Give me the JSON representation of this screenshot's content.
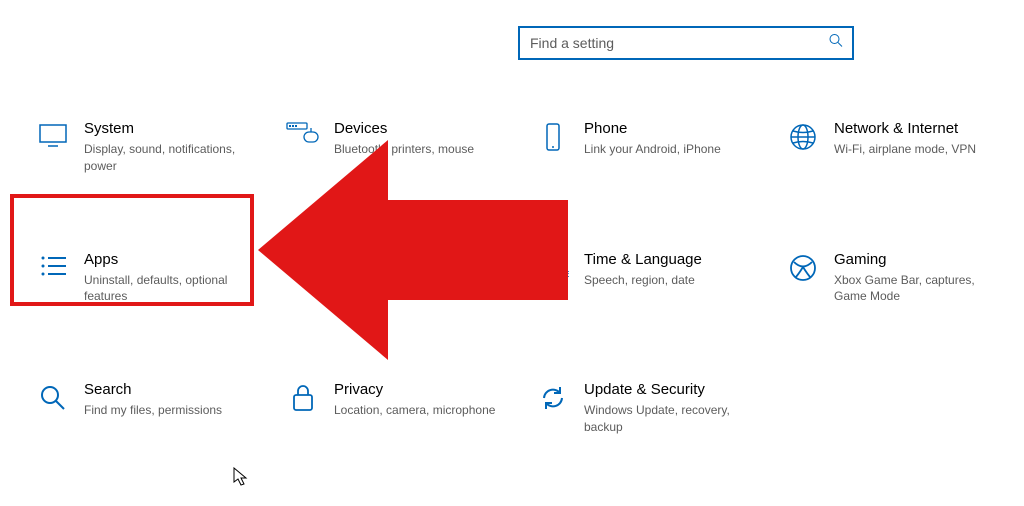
{
  "search": {
    "placeholder": "Find a setting"
  },
  "tiles": {
    "system": {
      "title": "System",
      "subtitle": "Display, sound, notifications, power"
    },
    "devices": {
      "title": "Devices",
      "subtitle": "Bluetooth, printers, mouse"
    },
    "phone": {
      "title": "Phone",
      "subtitle": "Link your Android, iPhone"
    },
    "network": {
      "title": "Network & Internet",
      "subtitle": "Wi-Fi, airplane mode, VPN"
    },
    "apps": {
      "title": "Apps",
      "subtitle": "Uninstall, defaults, optional features"
    },
    "time": {
      "title": "Time & Language",
      "subtitle": "Speech, region, date"
    },
    "gaming": {
      "title": "Gaming",
      "subtitle": "Xbox Game Bar, captures, Game Mode"
    },
    "search_t": {
      "title": "Search",
      "subtitle": "Find my files, permissions"
    },
    "privacy": {
      "title": "Privacy",
      "subtitle": "Location, camera, microphone"
    },
    "update": {
      "title": "Update & Security",
      "subtitle": "Windows Update, recovery, backup"
    }
  },
  "annotation": {
    "highlight_target": "apps",
    "arrow_color": "#e11717"
  }
}
